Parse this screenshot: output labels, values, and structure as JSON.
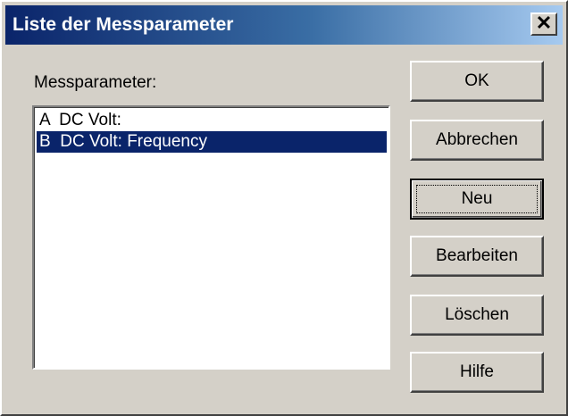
{
  "window": {
    "title": "Liste der Messparameter",
    "close_glyph": "×"
  },
  "list": {
    "label": "Messparameter:",
    "items": [
      {
        "text": "A  DC Volt:",
        "selected": false
      },
      {
        "text": "B  DC Volt: Frequency",
        "selected": true
      }
    ]
  },
  "buttons": {
    "ok": "OK",
    "cancel": "Abbrechen",
    "new": "Neu",
    "edit": "Bearbeiten",
    "delete": "Löschen",
    "help": "Hilfe"
  },
  "colors": {
    "face": "#d4d0c8",
    "title_start": "#0a246a",
    "title_end": "#a6caf0",
    "selection": "#0a246a"
  }
}
